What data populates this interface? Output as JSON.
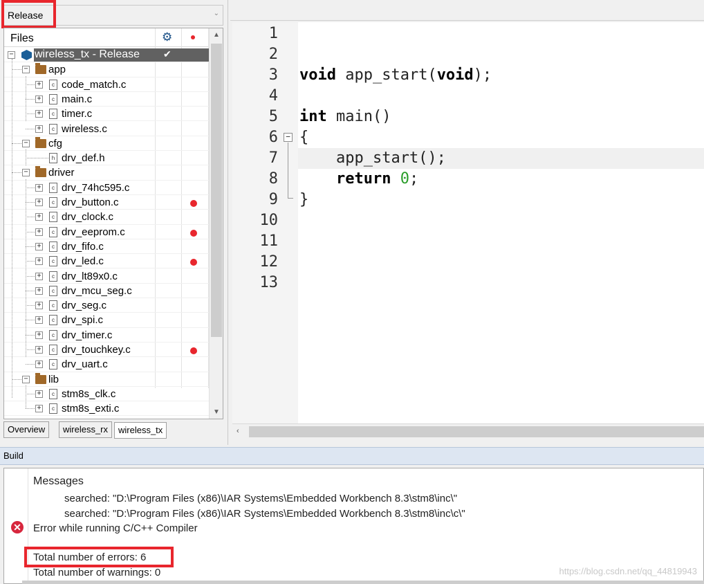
{
  "config": {
    "value": "Release"
  },
  "workspace": {
    "files_header": "Files",
    "project": {
      "label": "wireless_tx - Release"
    },
    "tree": [
      {
        "type": "folder",
        "name": "app"
      },
      {
        "type": "file",
        "name": "code_match.c",
        "breakpoint": false
      },
      {
        "type": "file",
        "name": "main.c",
        "breakpoint": false
      },
      {
        "type": "file",
        "name": "timer.c",
        "breakpoint": false
      },
      {
        "type": "file",
        "name": "wireless.c",
        "breakpoint": false
      },
      {
        "type": "folder",
        "name": "cfg"
      },
      {
        "type": "header",
        "name": "drv_def.h",
        "breakpoint": false
      },
      {
        "type": "folder",
        "name": "driver"
      },
      {
        "type": "file",
        "name": "drv_74hc595.c",
        "breakpoint": false
      },
      {
        "type": "file",
        "name": "drv_button.c",
        "breakpoint": true
      },
      {
        "type": "file",
        "name": "drv_clock.c",
        "breakpoint": false
      },
      {
        "type": "file",
        "name": "drv_eeprom.c",
        "breakpoint": true
      },
      {
        "type": "file",
        "name": "drv_fifo.c",
        "breakpoint": false
      },
      {
        "type": "file",
        "name": "drv_led.c",
        "breakpoint": true
      },
      {
        "type": "file",
        "name": "drv_lt89x0.c",
        "breakpoint": false
      },
      {
        "type": "file",
        "name": "drv_mcu_seg.c",
        "breakpoint": false
      },
      {
        "type": "file",
        "name": "drv_seg.c",
        "breakpoint": false
      },
      {
        "type": "file",
        "name": "drv_spi.c",
        "breakpoint": false
      },
      {
        "type": "file",
        "name": "drv_timer.c",
        "breakpoint": false
      },
      {
        "type": "file",
        "name": "drv_touchkey.c",
        "breakpoint": true
      },
      {
        "type": "file",
        "name": "drv_uart.c",
        "breakpoint": false
      },
      {
        "type": "folder",
        "name": "lib"
      },
      {
        "type": "file",
        "name": "stm8s_clk.c",
        "breakpoint": false
      },
      {
        "type": "file",
        "name": "stm8s_exti.c",
        "breakpoint": false
      }
    ],
    "tabs": [
      "Overview",
      "wireless_rx",
      "wireless_tx"
    ],
    "active_tab": "wireless_tx"
  },
  "editor": {
    "line_numbers": [
      "1",
      "2",
      "3",
      "4",
      "5",
      "6",
      "7",
      "8",
      "9",
      "10",
      "11",
      "12",
      "13"
    ],
    "code": {
      "line3": {
        "kw1": "void",
        "mid": " app_start(",
        "kw2": "void",
        "end": ");"
      },
      "line5": {
        "kw": "int",
        "rest": " main()"
      },
      "line6": "{",
      "line7": "    app_start();",
      "line8": {
        "indent": "    ",
        "kw": "return",
        "sp": " ",
        "num": "0",
        "end": ";"
      },
      "line9": "}"
    }
  },
  "build": {
    "title": "Build",
    "messages_header": "Messages",
    "lines": [
      "searched: \"D:\\Program Files (x86)\\IAR Systems\\Embedded Workbench 8.3\\stm8\\inc\\\"",
      "searched: \"D:\\Program Files (x86)\\IAR Systems\\Embedded Workbench 8.3\\stm8\\inc\\c\\\""
    ],
    "error_line": "Error while running C/C++ Compiler",
    "total_errors": "Total number of errors: 6",
    "total_warnings": "Total number of warnings: 0"
  },
  "watermark": "https://blog.csdn.net/qq_44819943",
  "colors": {
    "highlight_red": "#e8262d",
    "breakpoint_red": "#e8262d",
    "selection_gray": "#616161"
  }
}
